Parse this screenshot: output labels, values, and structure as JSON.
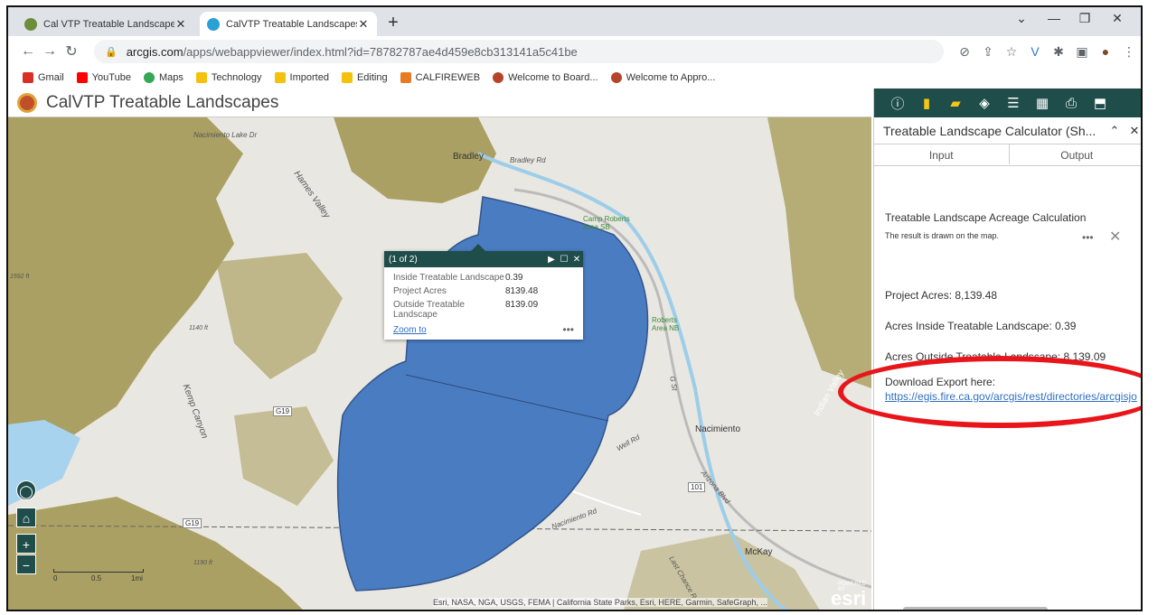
{
  "browser": {
    "tabs": [
      {
        "title": "Cal VTP Treatable Landscapes - V",
        "active": false,
        "favicon_color": "#6b8e3a"
      },
      {
        "title": "CalVTP Treatable Landscapes",
        "active": true,
        "favicon_color": "#2aa1d4"
      }
    ],
    "url_host": "arcgis.com",
    "url_path": "/apps/webappviewer/index.html?id=78782787ae4d459e8cb313141a5c41be",
    "bookmarks": [
      {
        "label": "Gmail",
        "color": "#d93025"
      },
      {
        "label": "YouTube",
        "color": "#ff0000"
      },
      {
        "label": "Maps",
        "color": "#34a853"
      },
      {
        "label": "Technology",
        "color": "#f4c20d"
      },
      {
        "label": "Imported",
        "color": "#f4c20d"
      },
      {
        "label": "Editing",
        "color": "#f4c20d"
      },
      {
        "label": "CALFIREWEB",
        "color": "#e67c22"
      },
      {
        "label": "Welcome to Board...",
        "color": "#b5442b"
      },
      {
        "label": "Welcome to Appro...",
        "color": "#b5442b"
      }
    ]
  },
  "app": {
    "title": "CalVTP Treatable Landscapes"
  },
  "map": {
    "labels": {
      "bradley": "Bradley",
      "bradley_rd": "Bradley Rd",
      "nacimiento_lake_dr": "Nacimiento Lake Dr",
      "hames_valley": "Hames Valley",
      "camp_roberts_sb": "Camp Roberts\nArea SB",
      "roberts_nb": "Roberts\nArea NB",
      "nacimiento": "Nacimiento",
      "mckay": "McKay",
      "well_rd": "Well Rd",
      "g19": "G19",
      "hwy101": "101",
      "indian_valley": "Indian Valley",
      "kemp_canyon": "Kemp Canyon",
      "nacimiento_rd": "Nacimiento Rd",
      "arizona_blvd": "Arizona Blvd",
      "last_chance": "Last Chance R",
      "g_st": "G St",
      "elev_1592": "1592 ft",
      "elev_1140": "1140 ft",
      "elev_1190": "1190 ft"
    },
    "scale": {
      "zero": "0",
      "mid": "0.5",
      "end": "1mi"
    },
    "attribution": "Esri, NASA, NGA, USGS, FEMA | California State Parks, Esri, HERE, Garmin, SafeGraph, ...",
    "esri_logo": "esri",
    "esri_powered": "POWERED BY"
  },
  "popup": {
    "count": "(1 of 2)",
    "rows": [
      {
        "label": "Inside Treatable Landscape",
        "value": "0.39"
      },
      {
        "label": "Project Acres",
        "value": "8139.48"
      },
      {
        "label": "Outside Treatable Landscape",
        "value": "8139.09"
      }
    ],
    "zoom_to": "Zoom to",
    "more": "•••"
  },
  "panel": {
    "title": "Treatable Landscape Calculator (Sh...",
    "tabs": [
      "Input",
      "Output"
    ],
    "heading": "Treatable Landscape Acreage Calculation",
    "subtext": "The result is drawn on the map.",
    "project_acres": "Project Acres: 8,139.48",
    "acres_inside": "Acres Inside Treatable Landscape: 0.39",
    "acres_outside": "Acres Outside Treatable Landscape: 8,139.09",
    "download_label": "Download Export here:",
    "download_link": "https://egis.fire.ca.gov/arcgis/rest/directories/arcgisjo"
  },
  "colors": {
    "theme": "#1f4d4a",
    "polygon": "#4a7cc2",
    "highlight": "#e8161b",
    "link": "#2f6fbf",
    "forest": "#a89c5c"
  }
}
